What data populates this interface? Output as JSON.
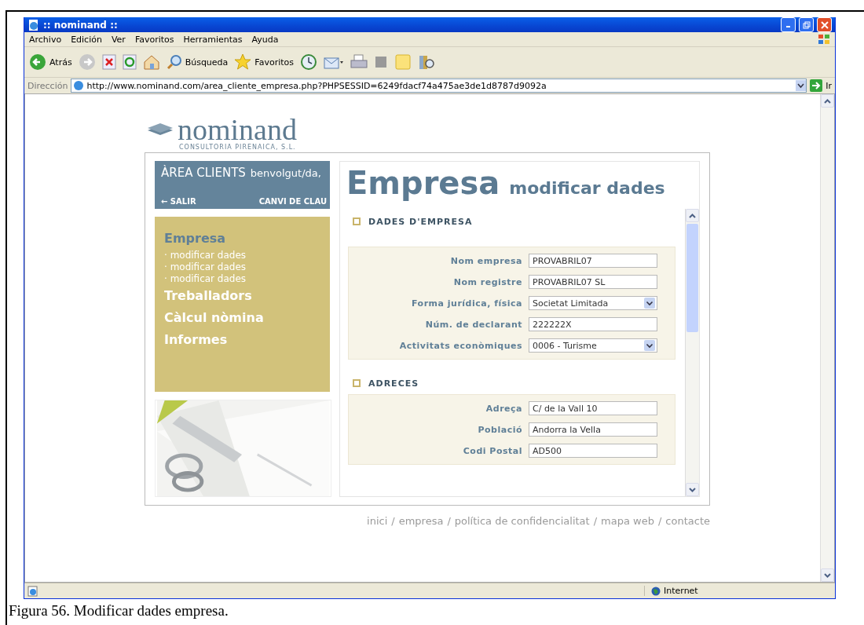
{
  "window": {
    "title": ":: nominand ::"
  },
  "menu": [
    "Archivo",
    "Edición",
    "Ver",
    "Favoritos",
    "Herramientas",
    "Ayuda"
  ],
  "toolbar": {
    "back": "Atrás",
    "search": "Búsqueda",
    "favorites": "Favoritos"
  },
  "address": {
    "label": "Dirección",
    "url": "http://www.nominand.com/area_cliente_empresa.php?PHPSESSID=6249fdacf74a475ae3de1d8787d9092a",
    "go": "Ir"
  },
  "logo": {
    "name": "nominand",
    "tagline": "CONSULTORIA PIRENAICA, S.L."
  },
  "client_area": {
    "title": "ÀREA CLIENTS",
    "greeting": "benvolgut/da,",
    "logout": "← SALIR",
    "change_password": "CANVI DE CLAU"
  },
  "nav": [
    {
      "label": "Empresa",
      "selected": true,
      "children": [
        {
          "label": "· modificar dades"
        },
        {
          "label": "· modificar dades"
        },
        {
          "label": "· modificar dades"
        }
      ]
    },
    {
      "label": "Treballadors",
      "selected": false
    },
    {
      "label": "Càlcul nòmina",
      "selected": false
    },
    {
      "label": "Informes",
      "selected": false
    }
  ],
  "heading": {
    "title": "Empresa",
    "subtitle": "modificar dades"
  },
  "sections": [
    {
      "title": "DADES D'EMPRESA",
      "fields": [
        {
          "label": "Nom empresa",
          "kind": "text",
          "value": "PROVABRIL07"
        },
        {
          "label": "Nom registre",
          "kind": "text",
          "value": "PROVABRIL07 SL"
        },
        {
          "label": "Forma jurídica, física",
          "kind": "select",
          "value": "Societat Limitada"
        },
        {
          "label": "Núm. de declarant",
          "kind": "text",
          "value": "222222X"
        },
        {
          "label": "Activitats econòmiques",
          "kind": "select",
          "value": "0006 - Turisme"
        }
      ]
    },
    {
      "title": "ADRECES",
      "fields": [
        {
          "label": "Adreça",
          "kind": "text",
          "value": "C/ de la Vall 10"
        },
        {
          "label": "Població",
          "kind": "text",
          "value": "Andorra la Vella"
        },
        {
          "label": "Codi Postal",
          "kind": "text",
          "value": "AD500"
        }
      ]
    }
  ],
  "footer": {
    "separator": "/",
    "links": [
      "inici",
      "empresa",
      "política de confidencialitat",
      "mapa web",
      "contacte"
    ]
  },
  "status_bar": {
    "zone": "Internet"
  },
  "caption": "Figura 56. Modificar dades empresa."
}
